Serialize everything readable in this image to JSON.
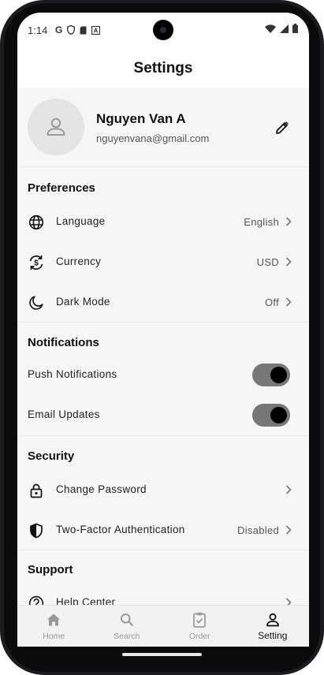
{
  "status_bar": {
    "time": "1:14",
    "left_icons": [
      "G",
      "shield-icon",
      "sim-icon",
      "A"
    ],
    "right_icons": [
      "wifi-icon",
      "signal-icon",
      "battery-icon"
    ]
  },
  "header": {
    "title": "Settings"
  },
  "profile": {
    "name": "Nguyen Van A",
    "email": "nguyenvana@gmail.com",
    "avatar_icon": "person-icon",
    "edit_icon": "pencil-icon"
  },
  "preferences": {
    "title": "Preferences",
    "items": [
      {
        "label": "Language",
        "value": "English",
        "icon": "globe-icon"
      },
      {
        "label": "Currency",
        "value": "USD",
        "icon": "currency-exchange-icon"
      },
      {
        "label": "Dark Mode",
        "value": "Off",
        "icon": "moon-icon"
      }
    ]
  },
  "notifications": {
    "title": "Notifications",
    "items": [
      {
        "label": "Push Notifications",
        "enabled": true
      },
      {
        "label": "Email Updates",
        "enabled": true
      }
    ]
  },
  "security": {
    "title": "Security",
    "items": [
      {
        "label": "Change Password",
        "value": "",
        "icon": "lock-icon"
      },
      {
        "label": "Two-Factor Authentication",
        "value": "Disabled",
        "icon": "shield-icon"
      }
    ]
  },
  "support": {
    "title": "Support",
    "items": [
      {
        "label": "Help Center",
        "icon": "help-icon"
      }
    ]
  },
  "bottom_nav": {
    "items": [
      {
        "label": "Home",
        "icon": "home-icon",
        "active": false
      },
      {
        "label": "Search",
        "icon": "search-icon",
        "active": false
      },
      {
        "label": "Order",
        "icon": "clipboard-check-icon",
        "active": false
      },
      {
        "label": "Setting",
        "icon": "person-icon",
        "active": true
      }
    ]
  },
  "colors": {
    "background": "#f6f6f6",
    "toggle_track": "#777777",
    "toggle_knob": "#000000",
    "nav_active": "#111111",
    "nav_inactive": "#999999"
  }
}
